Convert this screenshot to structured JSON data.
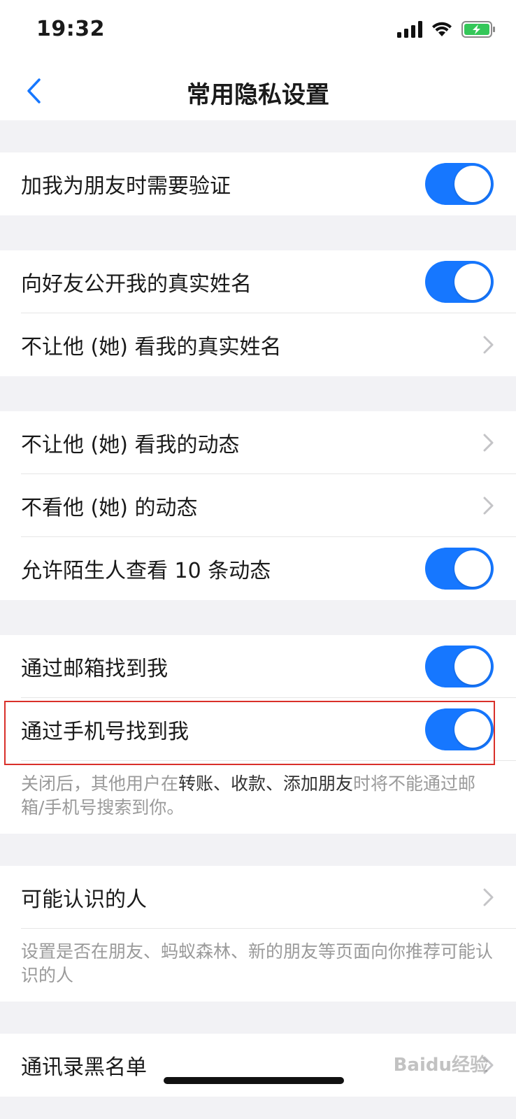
{
  "status_bar": {
    "time": "19:32",
    "icons": [
      "cellular-signal-icon",
      "wifi-icon",
      "battery-charging-icon"
    ]
  },
  "nav": {
    "title": "常用隐私设置",
    "back_icon": "chevron-left-icon"
  },
  "colors": {
    "accent": "#1677ff",
    "highlight_border": "#d9302a",
    "background": "#f2f2f5"
  },
  "sections": {
    "verify": {
      "label": "加我为朋友时需要验证",
      "on": true
    },
    "realname": {
      "public_label": "向好友公开我的真实姓名",
      "public_on": true,
      "hide_label": "不让他 (她) 看我的真实姓名"
    },
    "moments": {
      "block_label": "不让他 (她) 看我的动态",
      "hide_label": "不看他 (她) 的动态",
      "stranger_label": "允许陌生人查看 10 条动态",
      "stranger_on": true
    },
    "find": {
      "email_label": "通过邮箱找到我",
      "email_on": true,
      "phone_label": "通过手机号找到我",
      "phone_on": true,
      "note_part1": "关闭后，其他用户在",
      "note_strong": "转账、收款、添加朋友",
      "note_part2": "时将不能通过邮箱/手机号搜索到你。"
    },
    "people": {
      "label": "可能认识的人",
      "note": "设置是否在朋友、蚂蚁森林、新的朋友等页面向你推荐可能认识的人"
    },
    "blacklist": {
      "label": "通讯录黑名单"
    }
  },
  "watermark": "Baidu经验"
}
